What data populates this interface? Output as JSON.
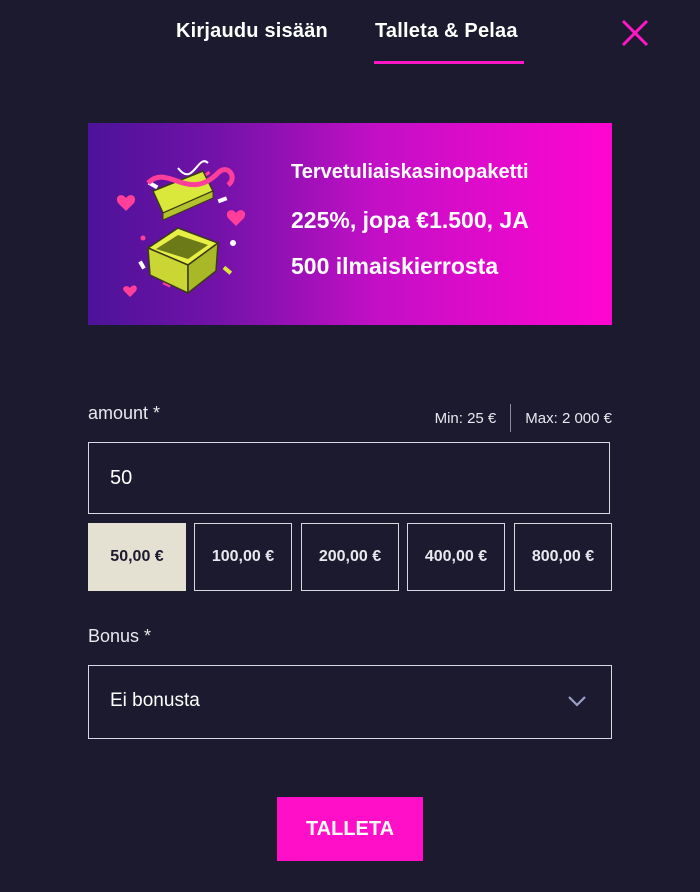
{
  "tabs": {
    "login_label": "Kirjaudu sisään",
    "deposit_label": "Talleta & Pelaa",
    "active": "deposit"
  },
  "banner": {
    "line1": "Tervetuliaiskasinopaketti",
    "line2": "225%, jopa €1.500, JA",
    "line3": "500 ilmaiskierrosta",
    "icon": "gift-box-icon"
  },
  "amount": {
    "label": "amount *",
    "min": "Min: 25 €",
    "max": "Max: 2 000 €",
    "value": "50",
    "presets": [
      "50,00 €",
      "100,00 €",
      "200,00 €",
      "400,00 €",
      "800,00 €"
    ],
    "selected_preset": "50,00 €"
  },
  "bonus": {
    "label": "Bonus *",
    "selected": "Ei bonusta"
  },
  "submit_label": "TALLETA",
  "colors": {
    "background": "#1b1a2e",
    "accent": "#ff10c8",
    "preset_active_bg": "#e4e0d2",
    "text": "#ffffff"
  }
}
